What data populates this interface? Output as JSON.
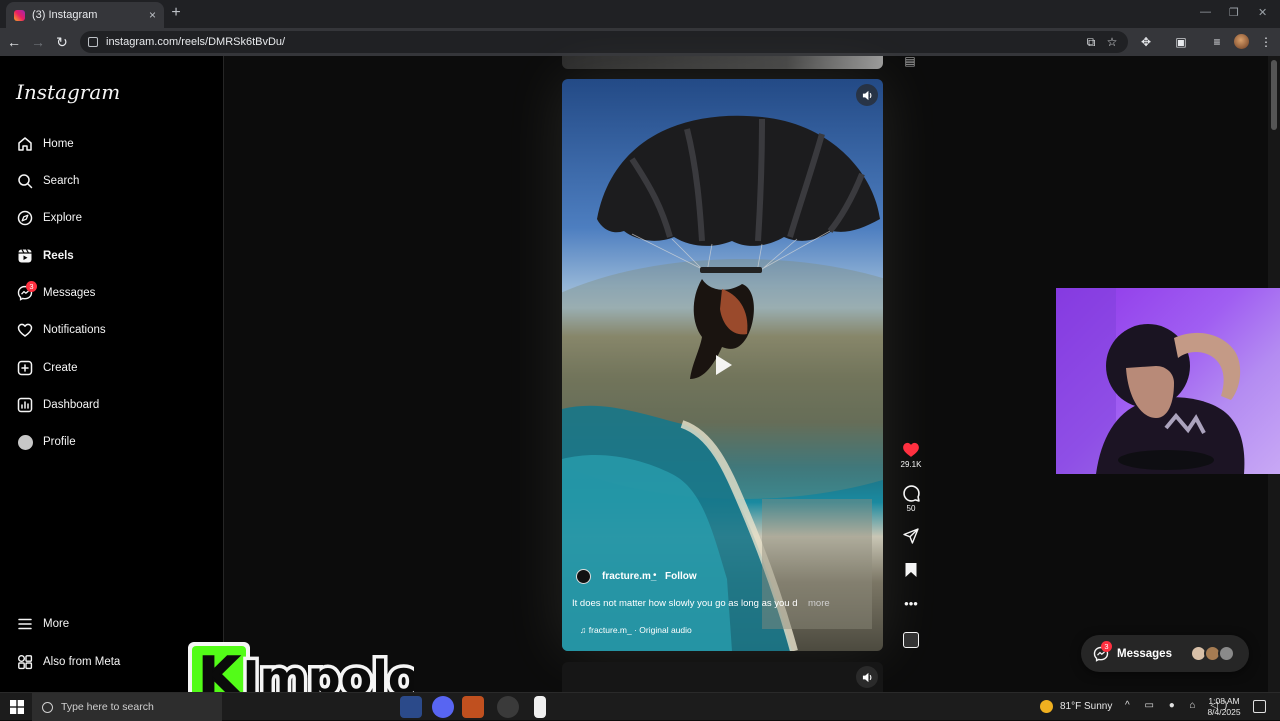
{
  "browser": {
    "tab_title": "(3) Instagram",
    "tab_close": "×",
    "new_tab": "+",
    "url": "instagram.com/reels/DMRSk6tBvDu/"
  },
  "sidebar": {
    "logo": "Instagram",
    "items": [
      {
        "label": "Home",
        "icon": "home-icon"
      },
      {
        "label": "Search",
        "icon": "search-icon"
      },
      {
        "label": "Explore",
        "icon": "compass-icon"
      },
      {
        "label": "Reels",
        "icon": "reels-icon"
      },
      {
        "label": "Messages",
        "icon": "messenger-icon",
        "badge": "3"
      },
      {
        "label": "Notifications",
        "icon": "heart-icon"
      },
      {
        "label": "Create",
        "icon": "plus-square-icon"
      },
      {
        "label": "Dashboard",
        "icon": "dashboard-icon"
      },
      {
        "label": "Profile",
        "icon": "avatar-icon"
      }
    ],
    "more": "More",
    "also_from_meta": "Also from Meta"
  },
  "reel": {
    "username": "fracture.m_",
    "separator": "•",
    "follow": "Follow",
    "caption": "It does not matter how slowly you go as long as you d...",
    "more": "more",
    "audio": "fracture.m_ · Original audio",
    "likes": "29.1K",
    "comments": "50"
  },
  "messages_pill": {
    "label": "Messages",
    "badge": "3"
  },
  "watermark": {
    "letter": "K",
    "text": "Impolo"
  },
  "taskbar": {
    "search_placeholder": "Type here to search",
    "weather": "81°F  Sunny",
    "time": "1:08 AM",
    "date": "8/4/2025"
  },
  "colors": {
    "accent_red": "#ff3040",
    "kick_green": "#53fc18",
    "webcam_purple": "#a05ef2"
  }
}
